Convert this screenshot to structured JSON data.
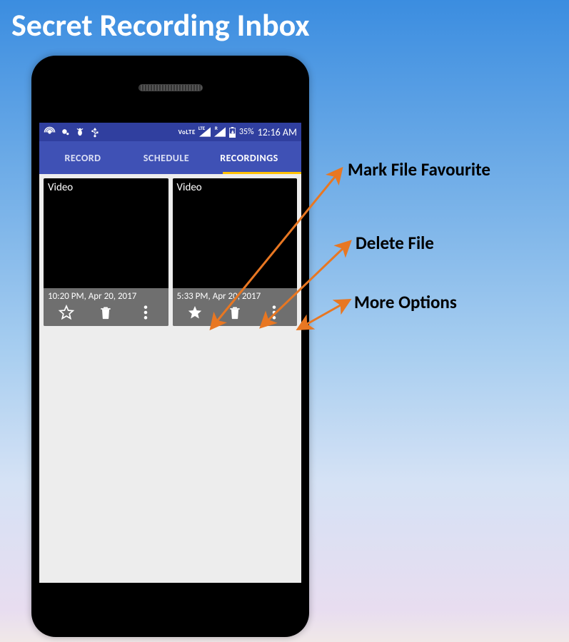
{
  "page": {
    "title": "Secret Recording Inbox"
  },
  "annotations": {
    "favourite": "Mark File Favourite",
    "delete": "Delete File",
    "more": "More Options"
  },
  "status_bar": {
    "volte_label": "VoLTE",
    "lte_label": "LTE",
    "r_label": "R",
    "battery_pct": "35%",
    "time": "12:16 AM"
  },
  "tabs": {
    "record": "RECORD",
    "schedule": "SCHEDULE",
    "recordings": "RECORDINGS"
  },
  "recordings": [
    {
      "type": "Video",
      "timestamp": "10:20 PM, Apr 20, 2017",
      "favourited": false
    },
    {
      "type": "Video",
      "timestamp": "5:33 PM, Apr 20, 2017",
      "favourited": true
    }
  ]
}
